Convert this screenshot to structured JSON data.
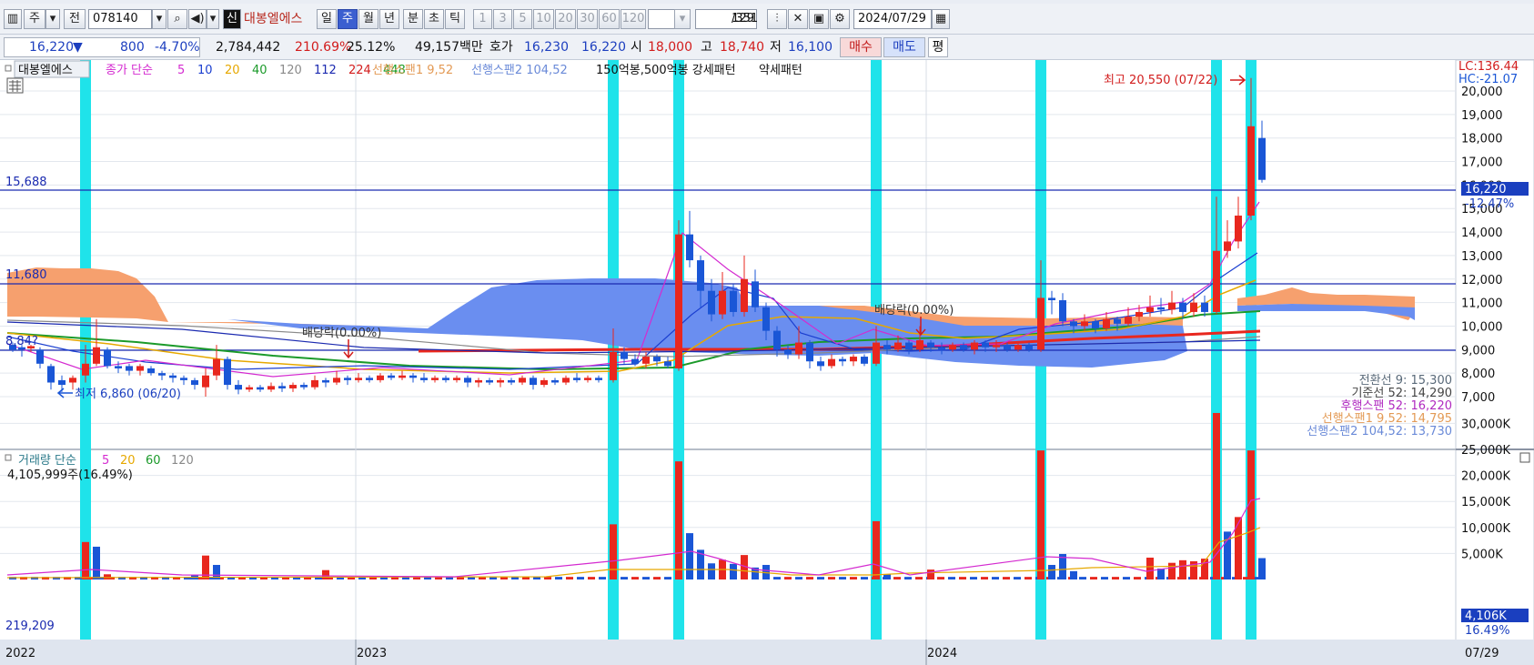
{
  "toolbar": {
    "period_label": "주",
    "jeon_label": "전",
    "code": "078140",
    "name_badge": "신",
    "name": "대봉엘에스",
    "periods": [
      "일",
      "주",
      "월",
      "년",
      "분",
      "초",
      "틱"
    ],
    "active_period": "주",
    "intervals": [
      "1",
      "3",
      "5",
      "10",
      "20",
      "30",
      "60",
      "120"
    ],
    "count": "129",
    "total": "/351",
    "date": "2024/07/29"
  },
  "quote": {
    "price": "16,220",
    "direction": "▼",
    "change": "800",
    "change_pct": "-4.70%",
    "volume": "2,784,442",
    "vol_ratio": "210.69%",
    "turnover": "25.12%",
    "amount": "49,157백만",
    "hoga_label": "호가",
    "ask": "16,230",
    "bid": "16,220",
    "open_label": "시",
    "open": "18,000",
    "high_label": "고",
    "high": "18,740",
    "low_label": "저",
    "low": "16,100",
    "buy_label": "매수",
    "sell_label": "매도",
    "avg_label": "평"
  },
  "colors": {
    "highlight": "#1fe3ea",
    "up": "#e8271e",
    "down": "#1a56d6",
    "cloud_orange": "#f6a06e",
    "cloud_blue": "#6a8ef0"
  },
  "price_legend": {
    "name": "대봉엘에스",
    "price_label": "종가 단순",
    "ma": [
      {
        "text": "5",
        "color": "#d42ad0"
      },
      {
        "text": "10",
        "color": "#1b3fd0"
      },
      {
        "text": "20",
        "color": "#e6a800"
      },
      {
        "text": "40",
        "color": "#1b9a2a"
      },
      {
        "text": "120",
        "color": "#8a8a8a"
      },
      {
        "text": "112",
        "color": "#1b2ab0"
      },
      {
        "text": "224",
        "color": "#d21c1c"
      },
      {
        "text": "448",
        "color": "#159c24"
      }
    ],
    "span1": "선행스팬1 9,52",
    "span2": "선행스팬2 104,52",
    "pattern": "150억봉,500억봉 강세패턴",
    "pattern2": "약세패턴"
  },
  "price_annotations": {
    "max_label": "최고 20,550 (07/22)",
    "min_label": "최저 6,860 (06/20)",
    "dividend1": "배당락(0.00%)",
    "dividend2": "배당락(0.00%)",
    "line1": "15,688",
    "line2": "11,680",
    "line3": "8,84?",
    "lc": "LC:136.44",
    "hc": "HC:-21.07",
    "current": "16,220",
    "current_pct": "-12.47%"
  },
  "price_axis": [
    "20,000",
    "19,000",
    "18,000",
    "17,000",
    "16,000",
    "15,000",
    "14,000",
    "13,000",
    "12,000",
    "11,000",
    "10,000",
    "9,000",
    "8,000",
    "7,000"
  ],
  "ichimoku_legend": [
    {
      "text": "전환선 9: 15,300",
      "color": "#5a6a7a"
    },
    {
      "text": "기준선 52: 14,290",
      "color": "#444444"
    },
    {
      "text": "후행스팬 52: 16,220",
      "color": "#b02ac0"
    },
    {
      "text": "선행스팬1 9,52: 14,795",
      "color": "#e39a55"
    },
    {
      "text": "선행스팬2 104,52: 13,730",
      "color": "#6a8ad8"
    }
  ],
  "volume_legend": {
    "label": "거래량 단순",
    "ma": [
      {
        "text": "5",
        "color": "#d42ad0"
      },
      {
        "text": "20",
        "color": "#e6a800"
      },
      {
        "text": "60",
        "color": "#1b9a2a"
      },
      {
        "text": "120",
        "color": "#8a8a8a"
      }
    ],
    "current": "4,105,999주(16.49%)",
    "avg": "219,209"
  },
  "volume_axis": [
    "30,000K",
    "25,000K",
    "20,000K",
    "15,000K",
    "10,000K",
    "5,000K"
  ],
  "volume_current": "4,106K",
  "volume_pct": "16.49%",
  "x_axis": [
    "2022",
    "2023",
    "2024"
  ],
  "x_right": "07/29"
}
